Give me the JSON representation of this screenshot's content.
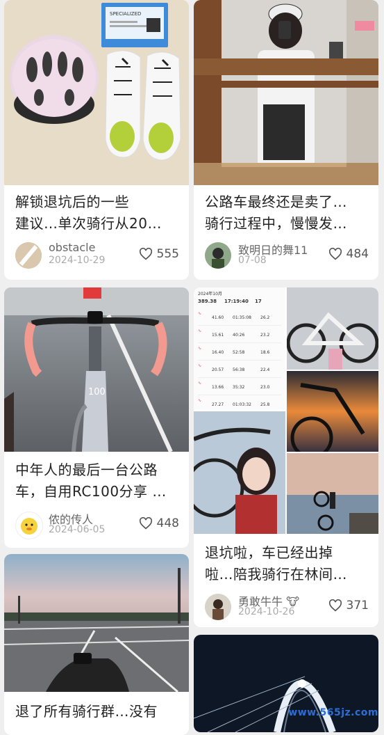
{
  "posts": [
    {
      "title": "解锁退坑后的一些\n建议…单次骑行从20…",
      "author": "obstacle",
      "date": "2024-10-29",
      "likes": "555"
    },
    {
      "title": "公路车最终还是卖了…\n骑行过程中，慢慢发…",
      "author": "致明日的舞11",
      "date": "07-08",
      "likes": "484"
    },
    {
      "title": "中年人的最后一台公路\n车，自用RC100分享 …",
      "author": "侬的传人",
      "date": "2024-06-05",
      "likes": "448"
    },
    {
      "title": "退坑啦，车已经出掉\n啦…陪我骑行在林间…",
      "author": "勇敢牛牛",
      "author_emoji": "🐮",
      "date": "2024-10-26",
      "likes": "371"
    },
    {
      "title": "退了所有骑行群…没有",
      "author": "",
      "date": "",
      "likes": ""
    }
  ],
  "ride_log": {
    "month": "2024年10月",
    "stats": [
      "389.38",
      "17:19:40",
      "17"
    ],
    "rows": [
      [
        "41.60",
        "01:35:08",
        "26.2"
      ],
      [
        "15.61",
        "40:26",
        "23.2"
      ],
      [
        "16.40",
        "52:58",
        "18.6"
      ],
      [
        "20.57",
        "56:38",
        "22.4"
      ],
      [
        "13.66",
        "35:32",
        "23.0"
      ],
      [
        "27.27",
        "01:03:32",
        "25.8"
      ]
    ]
  },
  "image_text": {
    "box_brand": "SPECIALIZED",
    "stem_number": "100"
  },
  "watermark": "www.565jz.com",
  "colors": {
    "like_icon": "#555555",
    "watermark": "#2b6fd6"
  }
}
